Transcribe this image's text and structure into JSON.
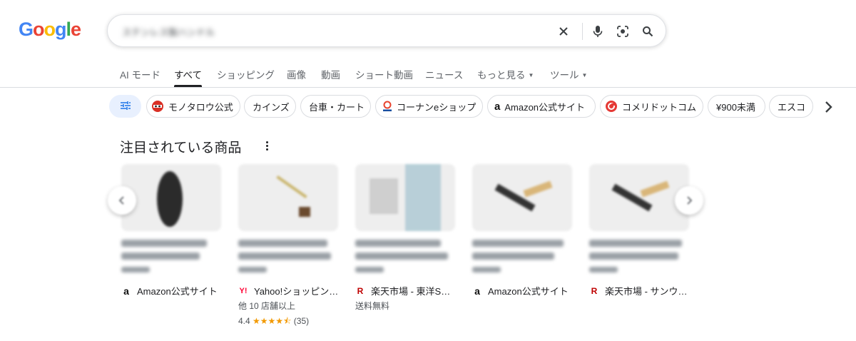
{
  "logo": {
    "text": "Google",
    "colors": [
      "#4285F4",
      "#EA4335",
      "#FBBC05",
      "#4285F4",
      "#34A853",
      "#EA4335"
    ]
  },
  "search": {
    "query": "ステンレス製ハンドル",
    "icons": [
      "close-icon",
      "mic-icon",
      "lens-icon",
      "search-icon"
    ]
  },
  "tabs": [
    {
      "label": "AI モード"
    },
    {
      "label": "すべて",
      "active": true
    },
    {
      "label": "ショッピング"
    },
    {
      "label": "画像"
    },
    {
      "label": "動画"
    },
    {
      "label": "ショート動画"
    },
    {
      "label": "ニュース"
    },
    {
      "label": "もっと見る"
    },
    {
      "label": "ツール"
    }
  ],
  "chips": [
    {
      "label": "モノタロウ公式",
      "icon": "monotaro-icon"
    },
    {
      "label": "カインズ"
    },
    {
      "label": "台車・カート"
    },
    {
      "label": "コーナンeショップ",
      "icon": "kohnan-icon"
    },
    {
      "label": "Amazon公式サイト",
      "icon": "amazon-icon"
    },
    {
      "label": "コメリドットコム",
      "icon": "komeri-icon"
    },
    {
      "label": "¥900未満"
    },
    {
      "label": "エスコ"
    }
  ],
  "section": {
    "title": "注目されている商品"
  },
  "products": [
    {
      "merchant": "Amazon公式サイト",
      "merchant_icon": "amazon-icon"
    },
    {
      "merchant": "Yahoo!ショッピン…",
      "merchant_icon": "yahoo-icon",
      "extra1": "他 10 店舗以上",
      "rating": "4.4",
      "stars": "★★★★⯪",
      "reviews": "(35)"
    },
    {
      "merchant": "楽天市場 - 東洋S…",
      "merchant_icon": "rakuten-icon",
      "extra1": "送料無料"
    },
    {
      "merchant": "Amazon公式サイト",
      "merchant_icon": "amazon-icon"
    },
    {
      "merchant": "楽天市場 - サンウ…",
      "merchant_icon": "rakuten-icon"
    }
  ]
}
